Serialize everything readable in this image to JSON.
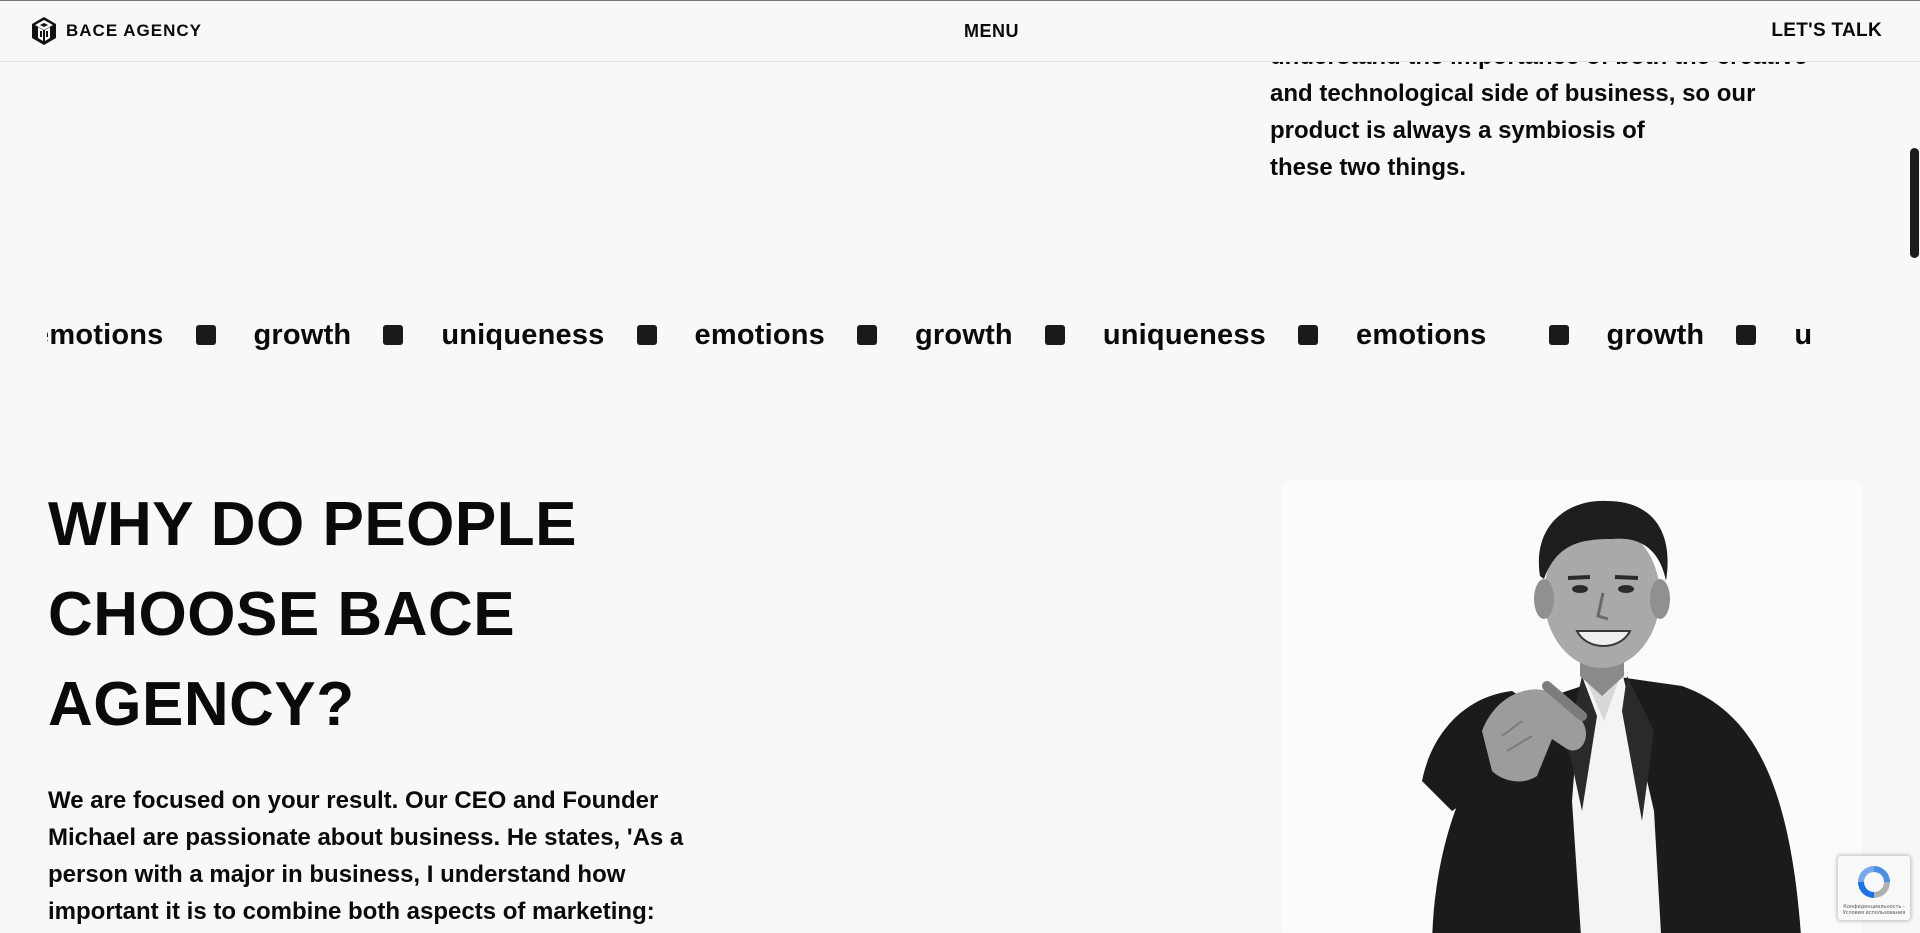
{
  "header": {
    "logo_text": "BACE AGENCY",
    "menu_label": "MENU",
    "cta_label": "LET'S TALK"
  },
  "intro": {
    "lines": [
      "understand the importance of both the creative",
      "and technological side of business, so our",
      "product is always a symbiosis of",
      "these two things."
    ]
  },
  "marquee": {
    "words": [
      "emotions",
      "growth",
      "uniqueness",
      "emotions",
      "growth",
      "uniqueness",
      "emotions",
      "growth",
      "u"
    ]
  },
  "why": {
    "title_lines": [
      "WHY DO PEOPLE",
      "CHOOSE BACE",
      "AGENCY?"
    ],
    "body_lines": [
      "We are focused on your result. Our CEO and Founder",
      "Michael are passionate about business. He states, 'As a",
      "person with a major in business, I understand how",
      "important it is to combine both aspects of marketing:"
    ]
  },
  "recaptcha": {
    "text": "Конфиденциальность - Условия использования"
  },
  "icons": {
    "logo": "bace-cube-logo-icon",
    "recaptcha": "recaptcha-icon"
  }
}
